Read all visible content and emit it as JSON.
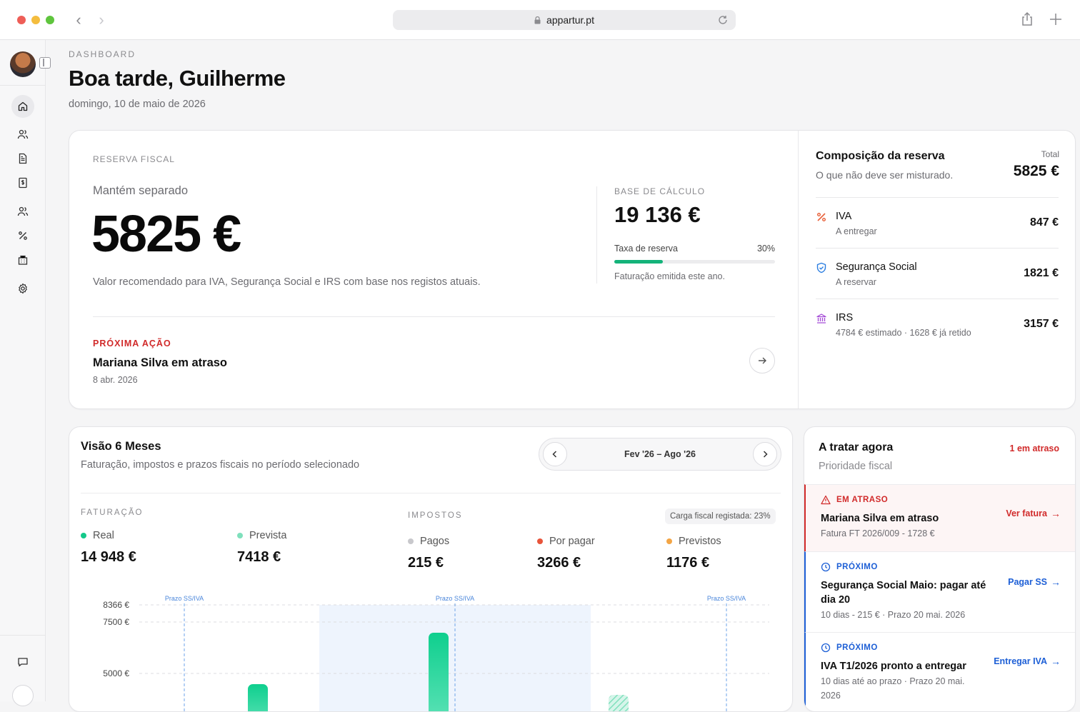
{
  "browser": {
    "url": "appartur.pt"
  },
  "header": {
    "eyebrow": "DASHBOARD",
    "title": "Boa tarde, Guilherme",
    "date": "domingo, 10 de maio de 2026"
  },
  "reserve": {
    "eyebrow": "RESERVA FISCAL",
    "subtitle": "Mantém separado",
    "amount": "5825 €",
    "description": "Valor recomendado para IVA, Segurança Social e IRS com base nos registos atuais.",
    "base_label": "BASE DE CÁLCULO",
    "base_amount": "19 136 €",
    "rate_label": "Taxa de reserva",
    "rate_value": "30%",
    "rate_fraction": 0.3,
    "rate_note": "Faturação emitida este ano.",
    "next_label": "PRÓXIMA AÇÃO",
    "next_title": "Mariana Silva em atraso",
    "next_date": "8 abr. 2026"
  },
  "composition": {
    "title": "Composição da reserva",
    "subtitle": "O que não deve ser misturado.",
    "total_label": "Total",
    "total": "5825 €",
    "rows": [
      {
        "icon": "percent-icon",
        "color": "#e8613a",
        "name": "IVA",
        "note": "A entregar",
        "value": "847 €"
      },
      {
        "icon": "shield-icon",
        "color": "#2a7de1",
        "name": "Segurança Social",
        "note": "A reservar",
        "value": "1821 €"
      },
      {
        "icon": "bank-icon",
        "color": "#a44ad6",
        "name": "IRS",
        "note": "4784 € estimado · 1628 € já retido",
        "value": "3157 €"
      }
    ]
  },
  "six_months": {
    "title": "Visão 6 Meses",
    "subtitle": "Faturação, impostos e prazos fiscais no período selecionado",
    "period": "Fev '26 – Ago '26",
    "fat_label": "FATURAÇÃO",
    "imp_label": "IMPOSTOS",
    "carga": "Carga fiscal registada: 23%",
    "metrics": {
      "real": {
        "label": "Real",
        "value": "14 948 €",
        "color": "#14c98a"
      },
      "prevista": {
        "label": "Prevista",
        "value": "7418 €",
        "color": "#7fe0bc"
      },
      "pagos": {
        "label": "Pagos",
        "value": "215 €",
        "color": "#c8c8cc"
      },
      "por_pagar": {
        "label": "Por pagar",
        "value": "3266 €",
        "color": "#e8543a"
      },
      "previstos": {
        "label": "Previstos",
        "value": "1176 €",
        "color": "#f3a545"
      }
    }
  },
  "chart_data": {
    "type": "bar",
    "y_tick_labels": [
      "8366 €",
      "7500 €",
      "5000 €"
    ],
    "y_ticks": [
      8366,
      7500,
      5000
    ],
    "deadline_label": "Prazo SS/IVA",
    "deadline_count": 3,
    "visible_bars": "partial (cropped at bottom)"
  },
  "todo": {
    "title": "A tratar agora",
    "subtitle": "Prioridade fiscal",
    "badge": "1 em atraso",
    "items": [
      {
        "tag": "EM ATRASO",
        "title": "Mariana Silva em atraso",
        "meta": "Fatura FT 2026/009 - 1728 €",
        "action": "Ver fatura"
      },
      {
        "tag": "PRÓXIMO",
        "title": "Segurança Social Maio: pagar até dia 20",
        "meta": "10 dias - 215 € · Prazo 20 mai. 2026",
        "action": "Pagar SS"
      },
      {
        "tag": "PRÓXIMO",
        "title": "IVA T1/2026 pronto a entregar",
        "meta": "10 dias até ao prazo · Prazo 20 mai. 2026",
        "action": "Entregar IVA"
      }
    ]
  },
  "colors": {
    "danger": "#d12a2a",
    "accent": "#1d5fd6",
    "success": "#14b37a"
  }
}
